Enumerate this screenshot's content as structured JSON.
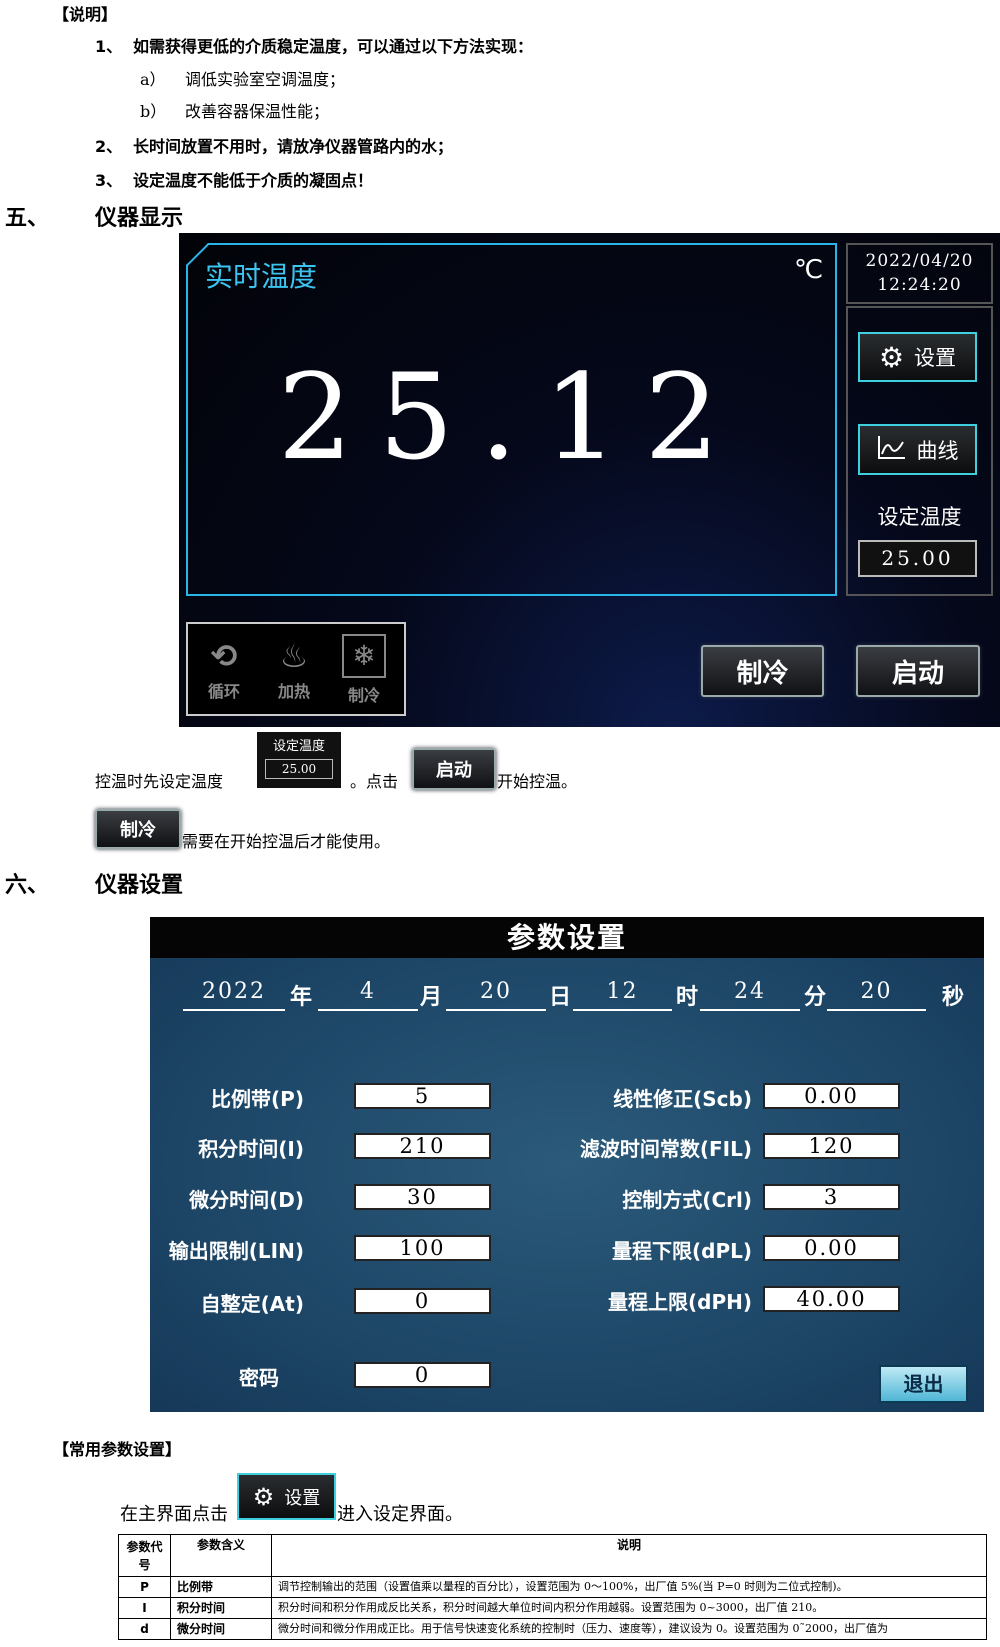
{
  "notes": {
    "heading": "【说明】",
    "items": [
      {
        "num": "1、",
        "text": "如需获得更低的介质稳定温度，可以通过以下方法实现："
      },
      {
        "num": "a）",
        "text": "调低实验室空调温度；"
      },
      {
        "num": "b）",
        "text": "改善容器保温性能；"
      },
      {
        "num": "2、",
        "text": "长时间放置不用时，请放净仪器管路内的水；"
      },
      {
        "num": "3、",
        "text": "设定温度不能低于介质的凝固点！"
      }
    ]
  },
  "section5": {
    "num": "五、",
    "title": "仪器显示"
  },
  "display": {
    "title": "实时温度",
    "unit": "℃",
    "temperature": "25.12",
    "date": "2022/04/20",
    "time": "12:24:20",
    "settings_btn": "设置",
    "curve_btn": "曲线",
    "set_temp_label": "设定温度",
    "set_temp_value": "25.00",
    "status": [
      "循环",
      "加热",
      "制冷"
    ],
    "cool_btn": "制冷",
    "start_btn": "启动",
    "accent": "#2ab5e8"
  },
  "instr": {
    "line1_a": "控温时先设定温度",
    "line1_b": "。点击",
    "line1_c": "开始控温。",
    "mini_label": "设定温度",
    "mini_value": "25.00",
    "mini_start": "启动",
    "mini_cool": "制冷",
    "line2": "需要在开始控温后才能使用。"
  },
  "section6": {
    "num": "六、",
    "title": "仪器设置"
  },
  "settings": {
    "title": "参数设置",
    "date": [
      {
        "v": "2022",
        "u": "年"
      },
      {
        "v": "4",
        "u": "月"
      },
      {
        "v": "20",
        "u": "日"
      },
      {
        "v": "12",
        "u": "时"
      },
      {
        "v": "24",
        "u": "分"
      },
      {
        "v": "20",
        "u": "秒"
      }
    ],
    "left": [
      {
        "label": "比例带(P)",
        "value": "5"
      },
      {
        "label": "积分时间(I)",
        "value": "210"
      },
      {
        "label": "微分时间(D)",
        "value": "30"
      },
      {
        "label": "输出限制(LIN)",
        "value": "100"
      },
      {
        "label": "自整定(At)",
        "value": "0"
      }
    ],
    "right": [
      {
        "label": "线性修正(Scb)",
        "value": "0.00"
      },
      {
        "label": "滤波时间常数(FIL)",
        "value": "120"
      },
      {
        "label": "控制方式(Crl)",
        "value": "3"
      },
      {
        "label": "量程下限(dPL)",
        "value": "0.00"
      },
      {
        "label": "量程上限(dPH)",
        "value": "40.00"
      }
    ],
    "password_label": "密码",
    "password_value": "0",
    "exit_btn": "退出"
  },
  "common": {
    "heading": "【常用参数设置】",
    "text_a": "在主界面点击",
    "btn": "设置",
    "text_b": "进入设定界面。"
  },
  "table": {
    "headers": [
      "参数代号",
      "参数含义",
      "说明"
    ],
    "rows": [
      {
        "code": "P",
        "name": "比例带",
        "desc": "调节控制输出的范围（设置值乘以量程的百分比），设置范围为 0～100%，出厂值 5%(当 P=0 时则为二位式控制)。"
      },
      {
        "code": "I",
        "name": "积分时间",
        "desc": "积分时间和积分作用成反比关系，积分时间越大单位时间内积分作用越弱。设置范围为 0~3000，出厂值 210。"
      },
      {
        "code": "d",
        "name": "微分时间",
        "desc": "微分时间和微分作用成正比。用于信号快速变化系统的控制时（压力、速度等），建议设为 0。设置范围为 0˜2000，出厂值为"
      }
    ]
  }
}
